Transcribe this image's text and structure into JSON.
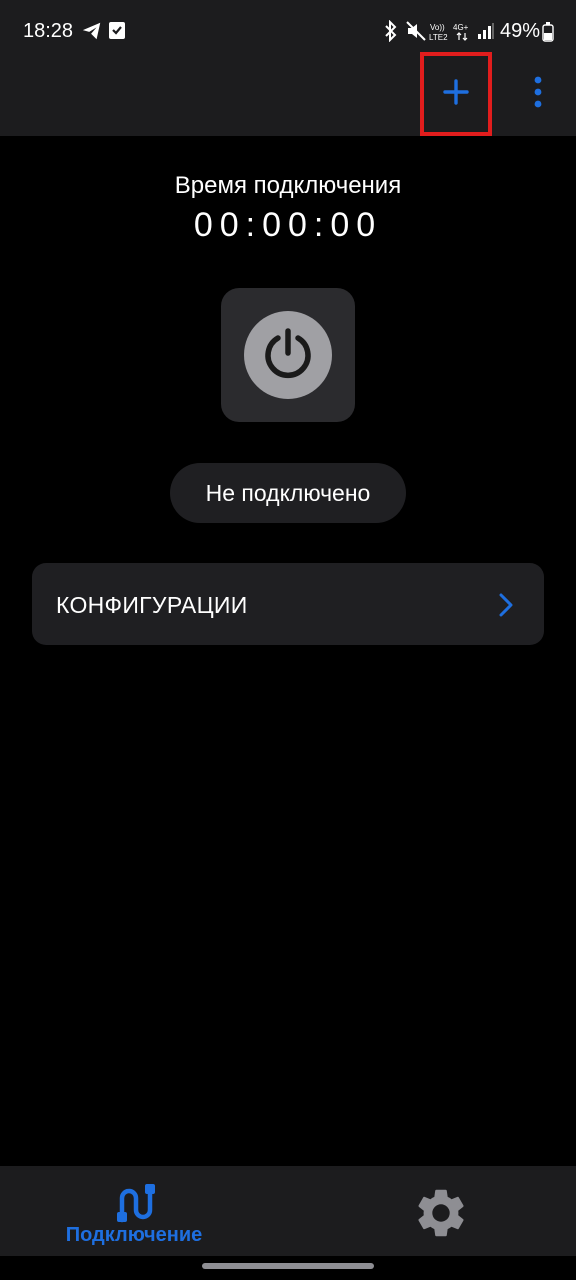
{
  "status_bar": {
    "time": "18:28",
    "battery_percent": "49%",
    "network_labels": {
      "volte": "Vo)) LTE2",
      "generation": "4G+"
    },
    "icons": [
      "telegram-icon",
      "check-notification-icon",
      "bluetooth-icon",
      "mute-icon",
      "volte-icon",
      "4g-plus-icon",
      "signal-icon",
      "battery-icon"
    ]
  },
  "toolbar": {
    "add_icon": "plus-icon",
    "menu_icon": "more-vertical-icon",
    "accent_color": "#1e6fe0",
    "highlight_color": "#e11d1d"
  },
  "main": {
    "connection_time_label": "Время подключения",
    "timer": "00:00:00",
    "power_icon": "power-icon",
    "status": "Не подключено",
    "configs_label": "КОНФИГУРАЦИИ",
    "configs_icon": "chevron-right-icon"
  },
  "bottom_nav": {
    "items": [
      {
        "label": "Подключение",
        "icon": "connection-icon",
        "active": true
      },
      {
        "label": "",
        "icon": "gear-icon",
        "active": false
      }
    ]
  }
}
